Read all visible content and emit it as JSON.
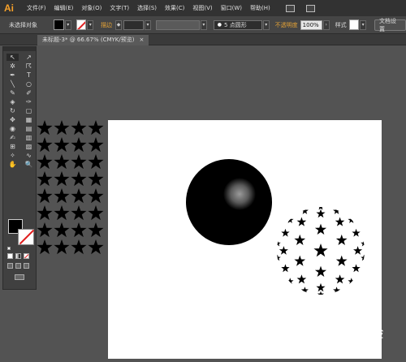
{
  "app": {
    "logo": "Ai"
  },
  "menu": [
    "文件(F)",
    "编辑(E)",
    "对象(O)",
    "文字(T)",
    "选择(S)",
    "效果(C)",
    "视图(V)",
    "窗口(W)",
    "帮助(H)"
  ],
  "control": {
    "selection_label": "未选择对象",
    "stroke_label": "描边",
    "brush_value": "5 点圆形",
    "opacity_label": "不透明度",
    "opacity_value": "100%",
    "style_label": "样式",
    "doc_setup": "文档设置"
  },
  "tab": {
    "title": "未标题-3* @ 66.67% (CMYK/预览)",
    "close": "×"
  },
  "tools": [
    "↖",
    "↗",
    "✲",
    "☈",
    "✒",
    "T",
    "╲",
    "○",
    "✎",
    "✐",
    "◈",
    "✑",
    "↻",
    "▢",
    "✥",
    "▦",
    "◉",
    "▤",
    "✍",
    "▥",
    "⊞",
    "▨",
    "✧",
    "∿",
    "✋",
    "🔍"
  ],
  "watermark": {
    "brand": "Bai",
    "brand2": "du",
    "sub": "经验",
    "url": "jingyan.baidu.com"
  },
  "colors": {
    "accent": "#f7a12a",
    "menubar": "#323232",
    "canvas": "#535353"
  }
}
